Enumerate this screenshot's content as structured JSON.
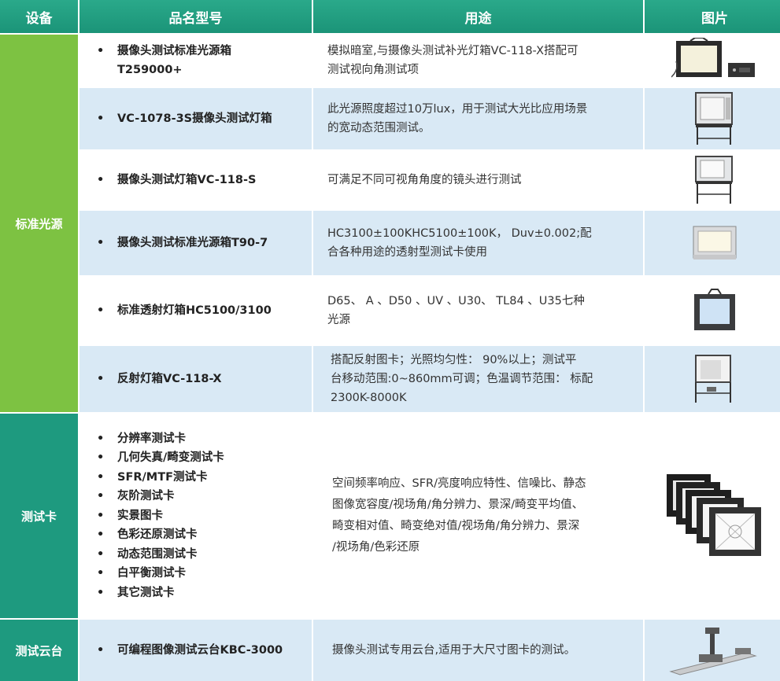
{
  "headers": {
    "device": "设备",
    "name": "品名型号",
    "usage": "用途",
    "image": "图片"
  },
  "categories": {
    "light_source": "标准光源",
    "test_card": "测试卡",
    "gimbal": "测试云台"
  },
  "rows": [
    {
      "name_line1": "摄像头测试标准光源箱",
      "name_line2": "T259000+",
      "usage_line1": "模拟暗室,与摄像头测试补光灯箱VC-118-X搭配可",
      "usage_line2": "测试视向角测试项"
    },
    {
      "name": "VC-1078-3S摄像头测试灯箱",
      "usage_line1": "此光源照度超过10万lux，用于测试大光比应用场景",
      "usage_line2": "的宽动态范围测试。"
    },
    {
      "name": "摄像头测试灯箱VC-118-S",
      "usage_line1": "可满足不同可视角角度的镜头进行测试"
    },
    {
      "name": "摄像头测试标准光源箱T90-7",
      "usage_line1": "HC3100±100KHC5100±100K，  Duv±0.002;配",
      "usage_line2": "合各种用途的透射型测试卡使用"
    },
    {
      "name": "标准透射灯箱HC5100/3100",
      "usage_line1": "D65、  A  、D50  、UV  、U30、  TL84  、U35七种",
      "usage_line2": "光源"
    },
    {
      "name": "反射灯箱VC-118-X",
      "usage_line1": "搭配反射图卡；光照均匀性：  90%以上；测试平",
      "usage_line2": "台移动范围:0~860mm可调；色温调节范围：  标配",
      "usage_line3": "2300K-8000K"
    }
  ],
  "test_cards": {
    "items": [
      "分辨率测试卡",
      "几何失真/畸变测试卡",
      "SFR/MTF测试卡",
      "灰阶测试卡",
      "实景图卡",
      "色彩还原测试卡",
      "动态范围测试卡",
      "白平衡测试卡",
      "其它测试卡"
    ],
    "usage_line1": "空间频率响应、SFR/亮度响应特性、信噪比、静态",
    "usage_line2": "图像宽容度/视场角/角分辨力、景深/畸变平均值、",
    "usage_line3": "畸变相对值、畸变绝对值/视场角/角分辨力、景深",
    "usage_line4": "/视场角/色彩还原"
  },
  "gimbal": {
    "name": "可编程图像测试云台KBC-3000",
    "usage_line1": "摄像头测试专用云台,适用于大尺寸图卡的测试。"
  },
  "colors": {
    "header": "#1b9478",
    "green": "#7dc242",
    "teal": "#1e9a7f",
    "row_blue": "#d9e9f5"
  },
  "icons": [
    "light-box-with-controller",
    "test-cabinet-on-stand",
    "test-cabinet-on-stand",
    "transmission-light-box",
    "light-box-panel",
    "reflective-light-box",
    "stacked-test-cards",
    "test-gimbal-rail"
  ]
}
